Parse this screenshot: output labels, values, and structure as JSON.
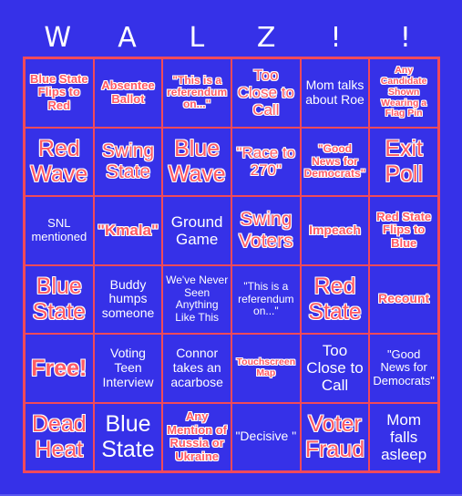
{
  "title_letters": [
    "W",
    "A",
    "L",
    "Z",
    "!",
    "!"
  ],
  "colors": {
    "background": "#3631e8",
    "grid_line": "#f04a5a",
    "marked_text": "#ff5a64",
    "plain_text": "#ffffff"
  },
  "board": {
    "rows": [
      [
        {
          "text": "Blue State Flips to Red",
          "marked": true
        },
        {
          "text": "Absentee Ballot",
          "marked": true
        },
        {
          "text": "\"This is a referendum on...\"",
          "marked": true
        },
        {
          "text": "Too Close to Call",
          "marked": true
        },
        {
          "text": "Mom talks about Roe",
          "marked": false
        },
        {
          "text": "Any Candidate Shown Wearing a Flag Pin",
          "marked": true
        }
      ],
      [
        {
          "text": "Red Wave",
          "marked": true
        },
        {
          "text": "Swing State",
          "marked": true
        },
        {
          "text": "Blue Wave",
          "marked": true
        },
        {
          "text": "\"Race to 270\"",
          "marked": true
        },
        {
          "text": "\"Good News for Democrats\"",
          "marked": true
        },
        {
          "text": "Exit Poll",
          "marked": true
        }
      ],
      [
        {
          "text": "SNL mentioned",
          "marked": false
        },
        {
          "text": "\"Kmala\"",
          "marked": true
        },
        {
          "text": "Ground Game",
          "marked": false
        },
        {
          "text": "Swing Voters",
          "marked": true
        },
        {
          "text": "Impeach",
          "marked": true
        },
        {
          "text": "Red State Flips to Blue",
          "marked": true
        }
      ],
      [
        {
          "text": "Blue State",
          "marked": true
        },
        {
          "text": "Buddy humps someone",
          "marked": false
        },
        {
          "text": "We've Never Seen Anything Like This",
          "marked": false
        },
        {
          "text": "\"This is a referendum on...\"",
          "marked": false
        },
        {
          "text": "Red State",
          "marked": true
        },
        {
          "text": "Recount",
          "marked": true
        }
      ],
      [
        {
          "text": "Free!",
          "marked": true
        },
        {
          "text": "Voting Teen Interview",
          "marked": false
        },
        {
          "text": "Connor takes an acarbose",
          "marked": false
        },
        {
          "text": "Touchscreen Map",
          "marked": true
        },
        {
          "text": "Too Close to Call",
          "marked": false
        },
        {
          "text": "\"Good News for Democrats\"",
          "marked": false
        }
      ],
      [
        {
          "text": "Dead Heat",
          "marked": true
        },
        {
          "text": "Blue State",
          "marked": false
        },
        {
          "text": "Any Mention of Russia or Ukraine",
          "marked": true
        },
        {
          "text": "\"Decisive \"",
          "marked": false
        },
        {
          "text": "Voter Fraud",
          "marked": true
        },
        {
          "text": "Mom falls asleep",
          "marked": false
        }
      ]
    ]
  }
}
